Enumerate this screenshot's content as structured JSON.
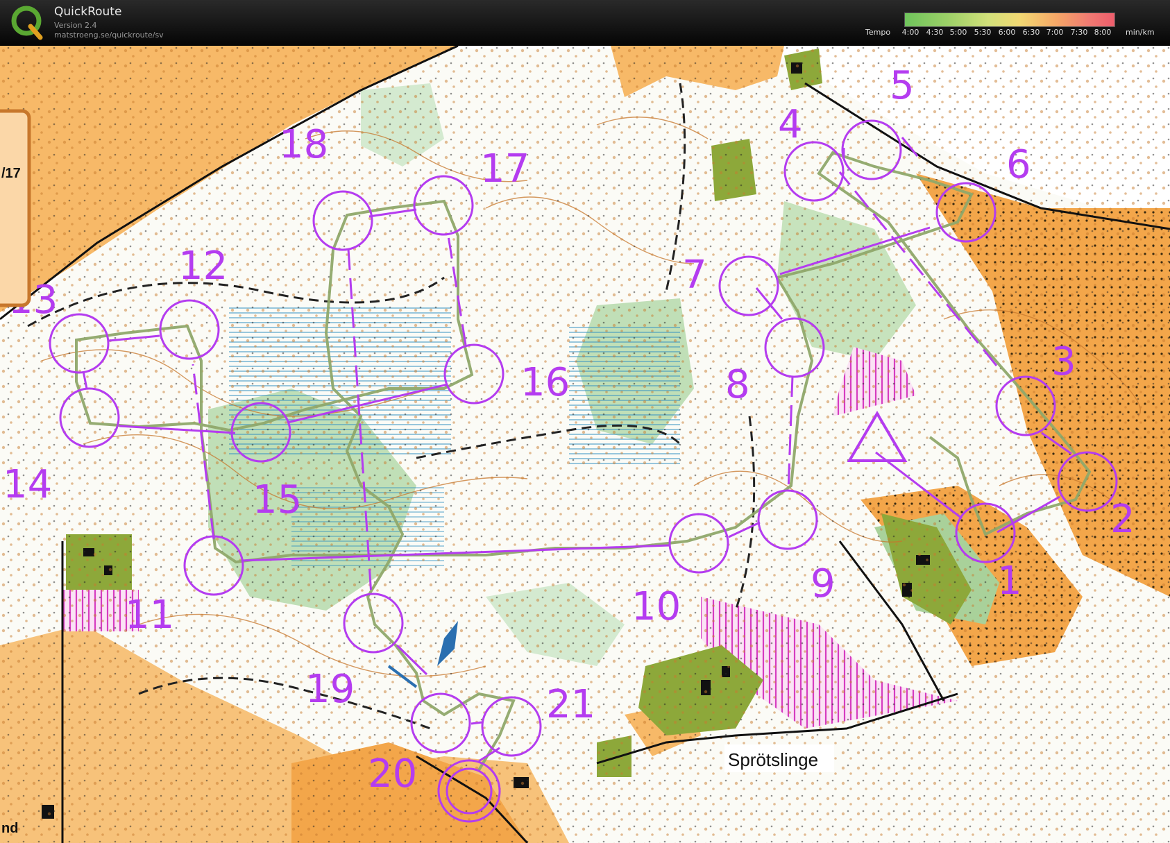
{
  "app": {
    "title": "QuickRoute",
    "version": "Version 2.4",
    "url": "matstroeng.se/quickroute/sv"
  },
  "pace_legend": {
    "label": "Tempo",
    "ticks": [
      "4:00",
      "4:30",
      "5:00",
      "5:30",
      "6:00",
      "6:30",
      "7:00",
      "7:30",
      "8:00"
    ],
    "unit": "min/km",
    "colors": [
      "#6fc45c",
      "#9bd067",
      "#d2e07a",
      "#f2d873",
      "#f5a867",
      "#f07a72",
      "#ee5d6c"
    ]
  },
  "map": {
    "course_color": "#b43cf0",
    "route_color": "#7fa86a",
    "controls": [
      "1",
      "2",
      "3",
      "4",
      "5",
      "6",
      "7",
      "8",
      "9",
      "10",
      "11",
      "12",
      "13",
      "14",
      "15",
      "16",
      "17",
      "18",
      "19",
      "20",
      "21"
    ],
    "place_name": "Sprötslinge",
    "edge_text_top": "/17",
    "edge_text_bottom": "nd"
  }
}
